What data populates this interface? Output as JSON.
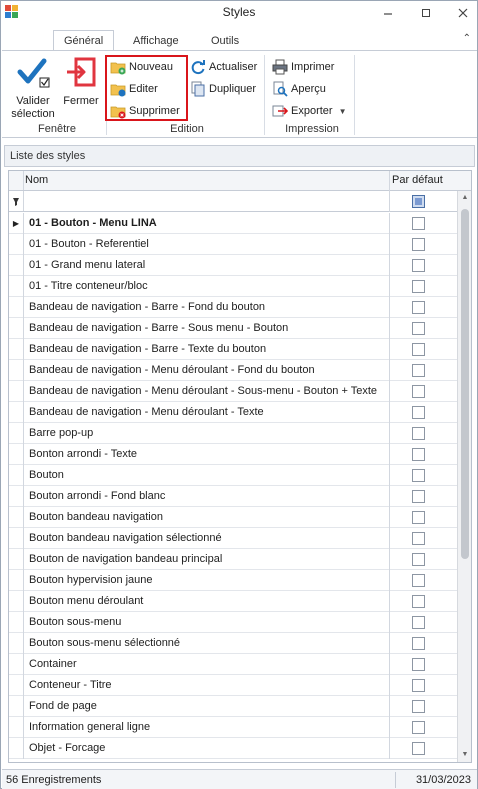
{
  "window": {
    "title": "Styles"
  },
  "ribbon": {
    "tabs": [
      {
        "label": "Général",
        "active": true
      },
      {
        "label": "Affichage",
        "active": false
      },
      {
        "label": "Outils",
        "active": false
      }
    ],
    "groups": {
      "fenetre": {
        "label": "Fenêtre",
        "validate_label_1": "Valider",
        "validate_label_2": "sélection",
        "close_label": "Fermer"
      },
      "edition": {
        "label": "Edition",
        "new_label": "Nouveau",
        "edit_label": "Editer",
        "delete_label": "Supprimer",
        "refresh_label": "Actualiser",
        "duplicate_label": "Dupliquer"
      },
      "impression": {
        "label": "Impression",
        "print_label": "Imprimer",
        "preview_label": "Aperçu",
        "export_label": "Exporter"
      }
    }
  },
  "panel": {
    "title": "Liste des styles"
  },
  "grid": {
    "columns": {
      "name": "Nom",
      "default": "Par défaut"
    },
    "rows": [
      {
        "name": "01 - Bouton - Menu LINA",
        "default": false
      },
      {
        "name": "01 - Bouton - Referentiel",
        "default": false
      },
      {
        "name": "01 - Grand menu lateral",
        "default": false
      },
      {
        "name": "01 - Titre conteneur/bloc",
        "default": false
      },
      {
        "name": "Bandeau de navigation - Barre - Fond du bouton",
        "default": false
      },
      {
        "name": "Bandeau de navigation - Barre - Sous menu - Bouton",
        "default": false
      },
      {
        "name": "Bandeau de navigation - Barre - Texte du bouton",
        "default": false
      },
      {
        "name": "Bandeau de navigation - Menu déroulant - Fond du bouton",
        "default": false
      },
      {
        "name": "Bandeau de navigation - Menu déroulant - Sous-menu - Bouton + Texte",
        "default": false
      },
      {
        "name": "Bandeau de navigation - Menu déroulant - Texte",
        "default": false
      },
      {
        "name": "Barre pop-up",
        "default": false
      },
      {
        "name": "Bonton arrondi - Texte",
        "default": false
      },
      {
        "name": "Bouton",
        "default": false
      },
      {
        "name": "Bouton arrondi - Fond blanc",
        "default": false
      },
      {
        "name": "Bouton bandeau navigation",
        "default": false
      },
      {
        "name": "Bouton bandeau navigation sélectionné",
        "default": false
      },
      {
        "name": "Bouton de navigation bandeau principal",
        "default": false
      },
      {
        "name": "Bouton hypervision jaune",
        "default": false
      },
      {
        "name": "Bouton menu déroulant",
        "default": false
      },
      {
        "name": "Bouton sous-menu",
        "default": false
      },
      {
        "name": "Bouton sous-menu sélectionné",
        "default": false
      },
      {
        "name": "Container",
        "default": false
      },
      {
        "name": "Conteneur - Titre",
        "default": false
      },
      {
        "name": "Fond de page",
        "default": false
      },
      {
        "name": "Information general ligne",
        "default": false
      },
      {
        "name": "Objet - Forcage",
        "default": false
      }
    ]
  },
  "status": {
    "records": "56 Enregistrements",
    "date": "31/03/2023"
  },
  "colors": {
    "highlight": "#d9151b",
    "accent": "#1e73be"
  }
}
